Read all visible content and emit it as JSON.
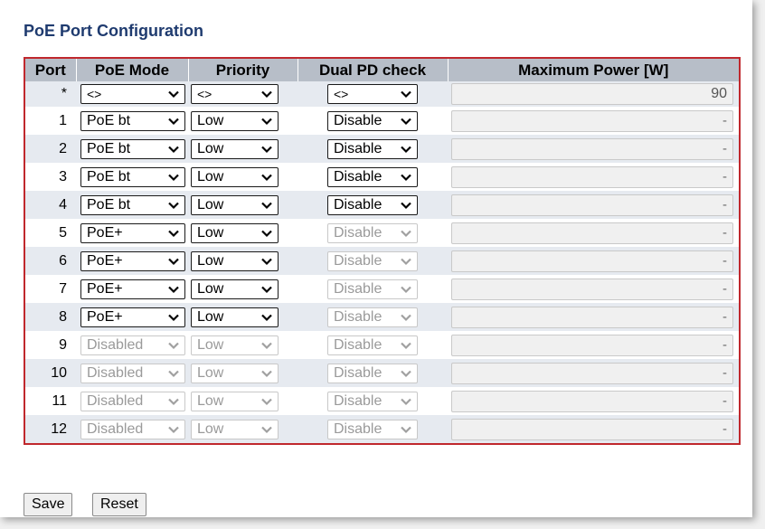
{
  "page": {
    "title": "PoE Port Configuration"
  },
  "table": {
    "headers": {
      "port": "Port",
      "mode": "PoE Mode",
      "priority": "Priority",
      "dual": "Dual PD check",
      "max": "Maximum Power [W]"
    },
    "star_row": {
      "port": "*",
      "mode": "<>",
      "priority": "<>",
      "dual": "<>",
      "max": "90"
    },
    "rows": [
      {
        "port": "1",
        "mode": "PoE bt",
        "priority": "Low",
        "dual": "Disable",
        "max": "-",
        "mode_enabled": true,
        "prio_enabled": true,
        "dual_enabled": true
      },
      {
        "port": "2",
        "mode": "PoE bt",
        "priority": "Low",
        "dual": "Disable",
        "max": "-",
        "mode_enabled": true,
        "prio_enabled": true,
        "dual_enabled": true
      },
      {
        "port": "3",
        "mode": "PoE bt",
        "priority": "Low",
        "dual": "Disable",
        "max": "-",
        "mode_enabled": true,
        "prio_enabled": true,
        "dual_enabled": true
      },
      {
        "port": "4",
        "mode": "PoE bt",
        "priority": "Low",
        "dual": "Disable",
        "max": "-",
        "mode_enabled": true,
        "prio_enabled": true,
        "dual_enabled": true
      },
      {
        "port": "5",
        "mode": "PoE+",
        "priority": "Low",
        "dual": "Disable",
        "max": "-",
        "mode_enabled": true,
        "prio_enabled": true,
        "dual_enabled": false
      },
      {
        "port": "6",
        "mode": "PoE+",
        "priority": "Low",
        "dual": "Disable",
        "max": "-",
        "mode_enabled": true,
        "prio_enabled": true,
        "dual_enabled": false
      },
      {
        "port": "7",
        "mode": "PoE+",
        "priority": "Low",
        "dual": "Disable",
        "max": "-",
        "mode_enabled": true,
        "prio_enabled": true,
        "dual_enabled": false
      },
      {
        "port": "8",
        "mode": "PoE+",
        "priority": "Low",
        "dual": "Disable",
        "max": "-",
        "mode_enabled": true,
        "prio_enabled": true,
        "dual_enabled": false
      },
      {
        "port": "9",
        "mode": "Disabled",
        "priority": "Low",
        "dual": "Disable",
        "max": "-",
        "mode_enabled": false,
        "prio_enabled": false,
        "dual_enabled": false
      },
      {
        "port": "10",
        "mode": "Disabled",
        "priority": "Low",
        "dual": "Disable",
        "max": "-",
        "mode_enabled": false,
        "prio_enabled": false,
        "dual_enabled": false
      },
      {
        "port": "11",
        "mode": "Disabled",
        "priority": "Low",
        "dual": "Disable",
        "max": "-",
        "mode_enabled": false,
        "prio_enabled": false,
        "dual_enabled": false
      },
      {
        "port": "12",
        "mode": "Disabled",
        "priority": "Low",
        "dual": "Disable",
        "max": "-",
        "mode_enabled": false,
        "prio_enabled": false,
        "dual_enabled": false
      }
    ]
  },
  "buttons": {
    "save": "Save",
    "reset": "Reset"
  },
  "colors": {
    "title": "#1f3b6f",
    "header_bg": "#b7bec8",
    "table_border": "#c0282d",
    "row_alt": "#e6eaf0"
  },
  "icons": {
    "select_arrow": "chevron-down-icon"
  }
}
